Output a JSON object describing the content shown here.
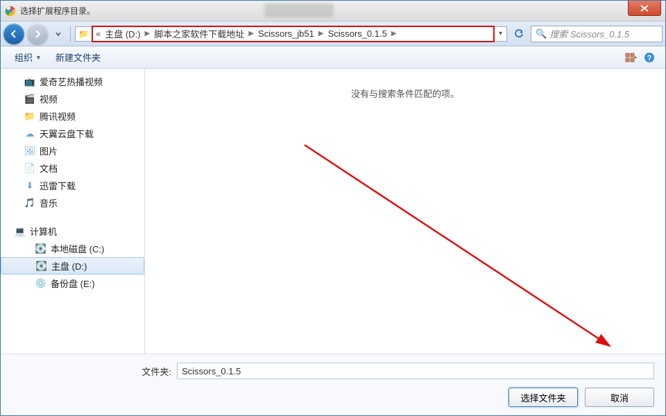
{
  "title": "选择扩展程序目录。",
  "breadcrumbs": [
    "主盘 (D:)",
    "脚本之家软件下载地址",
    "Scissors_jb51",
    "Scissors_0.1.5"
  ],
  "search": {
    "placeholder": "搜索 Scissors_0.1.5"
  },
  "toolbar": {
    "organize": "组织",
    "newfolder": "新建文件夹"
  },
  "sidebar": {
    "shortcuts": [
      {
        "icon": "📺",
        "label": "爱奇艺热播视频",
        "color": "#2fa84f"
      },
      {
        "icon": "🎬",
        "label": "视频",
        "color": "#3a7ab8"
      },
      {
        "icon": "📁",
        "label": "腾讯视频",
        "color": "#f0a020"
      },
      {
        "icon": "☁",
        "label": "天翼云盘下载",
        "color": "#6aa8d8"
      },
      {
        "icon": "🖼",
        "label": "图片",
        "color": "#6aa8d8"
      },
      {
        "icon": "📄",
        "label": "文档",
        "color": "#6aa8d8"
      },
      {
        "icon": "⬇",
        "label": "迅雷下载",
        "color": "#6aa8d8"
      },
      {
        "icon": "🎵",
        "label": "音乐",
        "color": "#3a9ad8"
      }
    ],
    "computer": {
      "icon": "💻",
      "label": "计算机"
    },
    "drives": [
      {
        "icon": "💽",
        "label": "本地磁盘 (C:)",
        "selected": false
      },
      {
        "icon": "💽",
        "label": "主盘 (D:)",
        "selected": true
      },
      {
        "icon": "💿",
        "label": "备份盘 (E:)",
        "selected": false
      }
    ]
  },
  "content": {
    "empty_msg": "没有与搜索条件匹配的项。"
  },
  "footer": {
    "folder_label": "文件夹:",
    "folder_value": "Scissors_0.1.5",
    "ok": "选择文件夹",
    "cancel": "取消"
  }
}
